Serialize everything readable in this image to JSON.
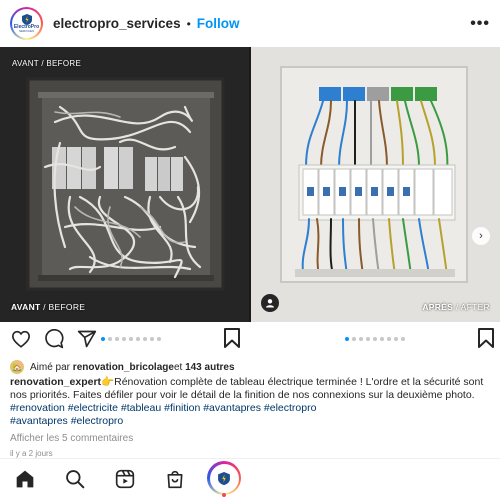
{
  "header": {
    "username": "electropro_services",
    "separator": "•",
    "follow_label": "Follow",
    "avatar_text": "ElectroPro",
    "avatar_subtext": "SERVICES"
  },
  "media": {
    "left_top_label": "AVANT / BEFORE",
    "left_bottom_label_bold": "AVANT",
    "left_bottom_label_rest": " / BEFORE",
    "right_bottom_label_bold": "APRÈS",
    "right_bottom_label_rest": " / AFTER",
    "left_dots_total": 9,
    "left_dots_active": 0,
    "right_dots_total": 9,
    "right_dots_active": 0
  },
  "likes": {
    "prefix": "Aimé par ",
    "user": "renovation_bricolage",
    "middle": " et ",
    "count": "143 autres"
  },
  "caption": {
    "author": "renovation_expert",
    "emoji": "👉",
    "text": "Rénovation complète de tableau électrique terminée ! L'ordre et la sécurité sont nos priorités. Faites défiler pour voir le détail de la finition de nos connexions sur la deuxième photo.",
    "hashtags_line1": "#renovation #electricite #tableau #finition #avantapres #electropro",
    "hashtags_line2": "#avantapres #electropro"
  },
  "comments_link": "Afficher les 5 commentaires",
  "timestamp": "il y a 2 jours",
  "colors": {
    "accent": "#0095f6",
    "hashtag": "#00376b",
    "muted": "#8e8e8e"
  },
  "icons": [
    "heart-icon",
    "comment-icon",
    "share-icon",
    "bookmark-icon",
    "home-icon",
    "search-icon",
    "reels-icon",
    "shop-icon",
    "profile-icon"
  ]
}
